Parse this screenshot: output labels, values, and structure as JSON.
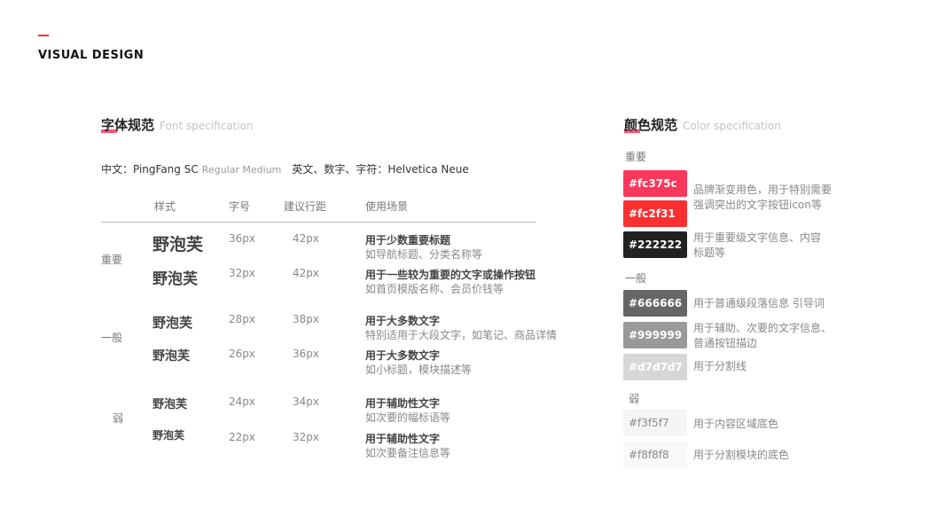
{
  "header": {
    "title": "VISUAL DESIGN"
  },
  "font_spec": {
    "title_zh": "字体规范",
    "title_en": "Font specification",
    "font_line": {
      "zh_label": "中文：PingFang SC",
      "weights": "Regular Medium",
      "en_label": "英文、数字、字符：Helvetica Neue"
    },
    "columns": [
      "样式",
      "字号",
      "建议行距",
      "使用场景"
    ],
    "groups": [
      "重要",
      "一般",
      "弱"
    ],
    "rows": [
      {
        "sample": "野泡芙",
        "size": "36px",
        "line_height": "42px",
        "usage": "用于少数重要标题",
        "example": "如导航标题、分类名称等"
      },
      {
        "sample": "野泡芙",
        "size": "32px",
        "line_height": "42px",
        "usage": "用于一些较为重要的文字或操作按钮",
        "example": "如首页模版名称、会员价钱等"
      },
      {
        "sample": "野泡芙",
        "size": "28px",
        "line_height": "38px",
        "usage": "用于大多数文字",
        "example": "特别适用于大段文字，如笔记、商品详情"
      },
      {
        "sample": "野泡芙",
        "size": "26px",
        "line_height": "36px",
        "usage": "用于大多数文字",
        "example": "如小标题，模块描述等"
      },
      {
        "sample": "野泡芙",
        "size": "24px",
        "line_height": "34px",
        "usage": "用于辅助性文字",
        "example": "如次要的幅标语等"
      },
      {
        "sample": "野泡芙",
        "size": "22px",
        "line_height": "32px",
        "usage": "用于辅助性文字",
        "example": "如次要备注信息等"
      }
    ]
  },
  "color_spec": {
    "title_zh": "颜色规范",
    "title_en": "Color specification",
    "groups": [
      "重要",
      "一般",
      "弱"
    ],
    "swatches": [
      {
        "hex": "#fc375c",
        "bg": "#fc375c",
        "fg": "#ffffff"
      },
      {
        "hex": "#fc2f31",
        "bg": "#fc2f31",
        "fg": "#ffffff"
      },
      {
        "hex": "#222222",
        "bg": "#222222",
        "fg": "#ffffff"
      },
      {
        "hex": "#666666",
        "bg": "#666666",
        "fg": "#ffffff"
      },
      {
        "hex": "#999999",
        "bg": "#999999",
        "fg": "#ffffff"
      },
      {
        "hex": "#d7d7d7",
        "bg": "#d7d7d7",
        "fg": "#ffffff"
      },
      {
        "hex": "#f3f5f7",
        "bg": "#f3f5f7",
        "fg": "#888888"
      },
      {
        "hex": "#f8f8f8",
        "bg": "#f8f8f8",
        "fg": "#888888"
      }
    ],
    "descriptions": {
      "brand_1": "品牌渐变用色，用于特别需要",
      "brand_2": "强调突出的文字按钮icon等",
      "c222_1": "用于重要级文字信息、内容",
      "c222_2": "标题等",
      "c666": "用于普通级段落信息 引导词",
      "c999_1": "用于辅助、次要的文字信息、",
      "c999_2": "普通按钮描边",
      "cd7": "用于分割线",
      "cf3": "用于内容区域底色",
      "cf8": "用于分割模块的底色"
    }
  }
}
